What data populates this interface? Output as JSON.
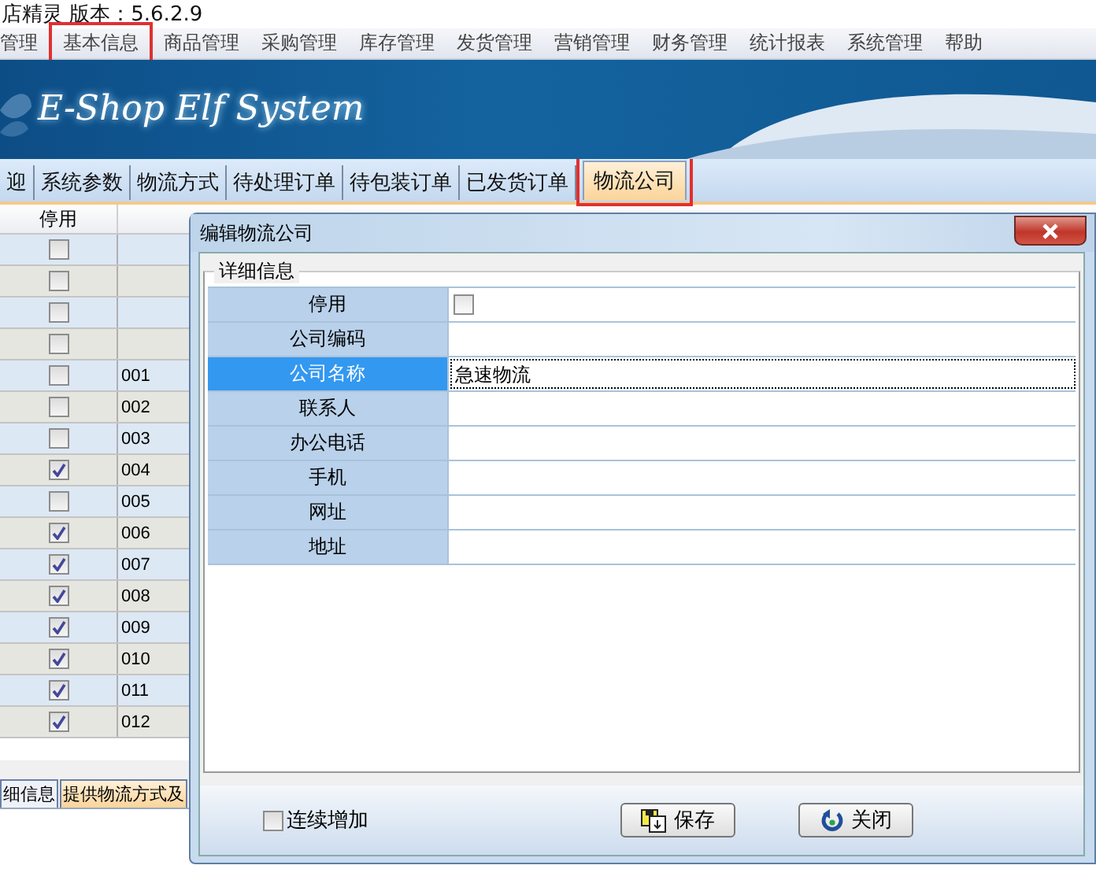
{
  "app": {
    "title": "店精灵  版本：5.6.2.9"
  },
  "menu": [
    {
      "label": "管理",
      "marked": false
    },
    {
      "label": "基本信息",
      "marked": true
    },
    {
      "label": "商品管理",
      "marked": false
    },
    {
      "label": "采购管理",
      "marked": false
    },
    {
      "label": "库存管理",
      "marked": false
    },
    {
      "label": "发货管理",
      "marked": false
    },
    {
      "label": "营销管理",
      "marked": false
    },
    {
      "label": "财务管理",
      "marked": false
    },
    {
      "label": "统计报表",
      "marked": false
    },
    {
      "label": "系统管理",
      "marked": false
    },
    {
      "label": "帮助",
      "marked": false
    }
  ],
  "banner": {
    "logo": "E-Shop Elf System"
  },
  "tabs": [
    {
      "label": "迎",
      "selected": false,
      "marked": false
    },
    {
      "label": "系统参数",
      "selected": false,
      "marked": false
    },
    {
      "label": "物流方式",
      "selected": false,
      "marked": false
    },
    {
      "label": "待处理订单",
      "selected": false,
      "marked": false
    },
    {
      "label": "待包装订单",
      "selected": false,
      "marked": false
    },
    {
      "label": "已发货订单",
      "selected": false,
      "marked": false
    },
    {
      "label": "物流公司",
      "selected": true,
      "marked": true
    }
  ],
  "table": {
    "columns": [
      "停用"
    ],
    "rows": [
      {
        "disabled": false,
        "code": ""
      },
      {
        "disabled": false,
        "code": ""
      },
      {
        "disabled": false,
        "code": ""
      },
      {
        "disabled": false,
        "code": ""
      },
      {
        "disabled": false,
        "code": "001"
      },
      {
        "disabled": false,
        "code": "002"
      },
      {
        "disabled": false,
        "code": "003"
      },
      {
        "disabled": true,
        "code": "004"
      },
      {
        "disabled": false,
        "code": "005"
      },
      {
        "disabled": true,
        "code": "006"
      },
      {
        "disabled": true,
        "code": "007"
      },
      {
        "disabled": true,
        "code": "008"
      },
      {
        "disabled": true,
        "code": "009"
      },
      {
        "disabled": true,
        "code": "010"
      },
      {
        "disabled": true,
        "code": "011"
      },
      {
        "disabled": true,
        "code": "012"
      }
    ]
  },
  "bottom_tabs": [
    {
      "label": "细信息",
      "selected": false
    },
    {
      "label": "提供物流方式及",
      "selected": true
    }
  ],
  "dialog": {
    "title": "编辑物流公司",
    "group": "详细信息",
    "fields": [
      {
        "label": "停用",
        "kind": "checkbox",
        "checked": false,
        "selected": false
      },
      {
        "label": "公司编码",
        "kind": "text",
        "selected": false
      },
      {
        "label": "公司名称",
        "kind": "text",
        "value": "急速物流",
        "selected": true
      },
      {
        "label": "联系人",
        "kind": "text",
        "selected": false
      },
      {
        "label": "办公电话",
        "kind": "text",
        "selected": false
      },
      {
        "label": "手机",
        "kind": "text",
        "selected": false
      },
      {
        "label": "网址",
        "kind": "text",
        "selected": false
      },
      {
        "label": "地址",
        "kind": "text",
        "selected": false
      }
    ],
    "continuous_add": {
      "label": "连续增加",
      "checked": false
    },
    "buttons": [
      {
        "label": "保存",
        "kind": "save"
      },
      {
        "label": "关闭",
        "kind": "close"
      }
    ]
  }
}
